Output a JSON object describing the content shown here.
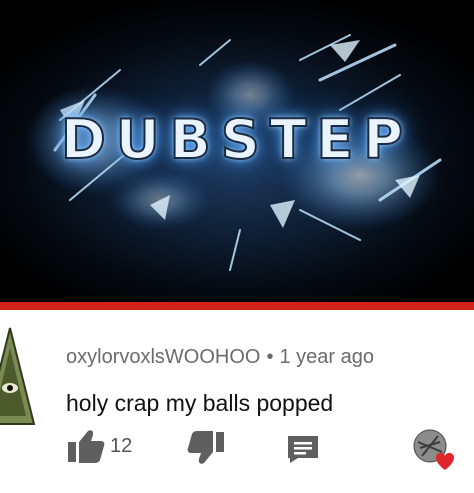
{
  "video": {
    "title_art_text": "DUBSTEP",
    "progress_fraction": 1.0,
    "colors": {
      "glow": "#5aa9ff",
      "progress": "#d4231b",
      "background": "#050a12"
    }
  },
  "comment": {
    "author": "oxylorvoxlsWOOHOO",
    "separator": "•",
    "timestamp": "1 year ago",
    "text": "holy crap my balls popped",
    "like_count": "12"
  },
  "icons": {
    "like": "thumbs-up-icon",
    "dislike": "thumbs-down-icon",
    "reply": "reply-icon",
    "heart": "creator-heart-icon",
    "avatar": "avatar"
  }
}
